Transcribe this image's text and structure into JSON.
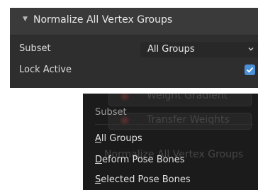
{
  "operator_panel": {
    "title": "Normalize All Vertex Groups",
    "subset": {
      "label": "Subset",
      "value": "All Groups"
    },
    "lock_active": {
      "label": "Lock Active",
      "checked": true
    }
  },
  "menu": {
    "title": "Subset",
    "items": [
      {
        "hotkey": "A",
        "rest": "ll Groups"
      },
      {
        "hotkey": "D",
        "rest": "eform Pose Bones"
      },
      {
        "hotkey": "S",
        "rest": "elected Pose Bones"
      }
    ]
  },
  "background": {
    "weight_gradient": "Weight Gradient",
    "transfer_weights": "Transfer Weights",
    "normalize_ghost": "Normalize All Vertex Groups"
  },
  "colors": {
    "panel_bg": "#2e2e2e",
    "header_bg": "#3a3a3a",
    "dropdown_bg": "#282828",
    "checkbox_accent": "#4a90d9",
    "menu_bg": "#1b1b1b"
  }
}
